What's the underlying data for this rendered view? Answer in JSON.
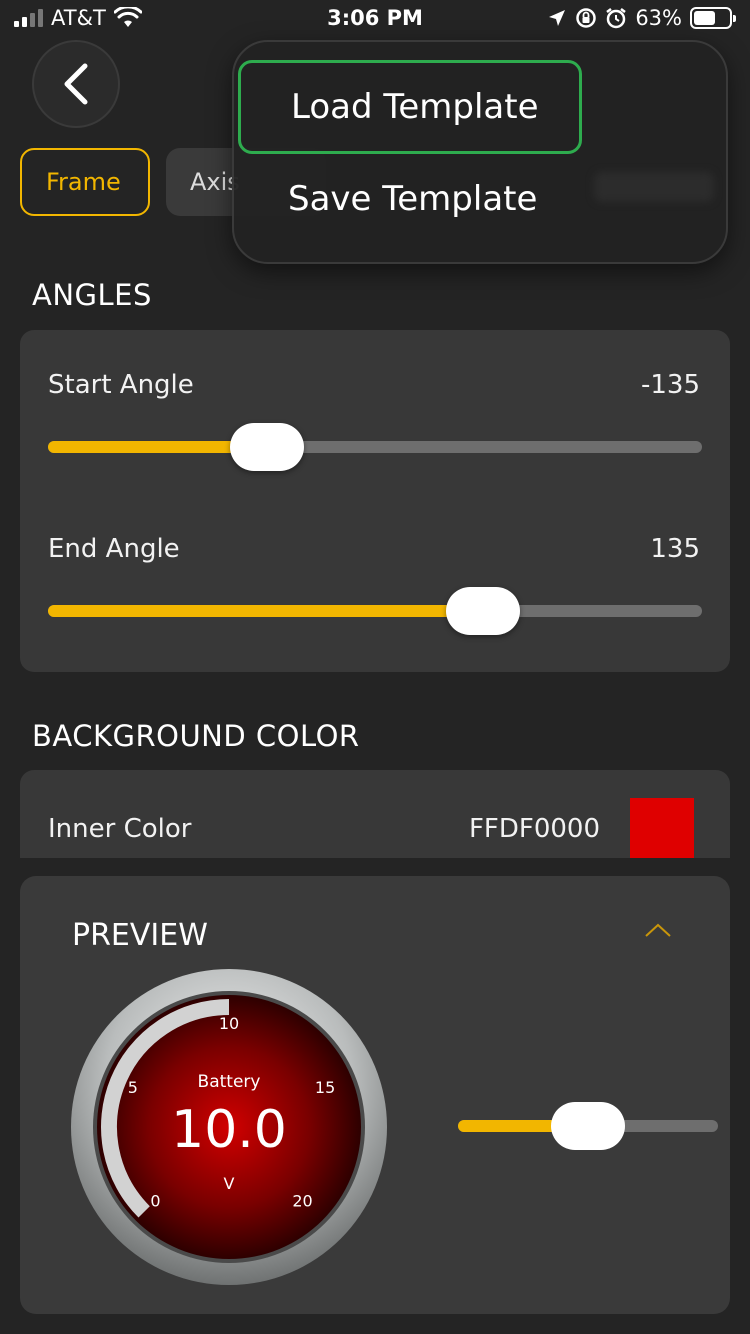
{
  "status": {
    "carrier": "AT&T",
    "time": "3:06 PM",
    "battery_percent": "63%",
    "battery_level": 0.63,
    "icons": [
      "signal-icon",
      "wifi-icon",
      "location-icon",
      "rotation-lock-icon",
      "alarm-icon",
      "battery-icon"
    ]
  },
  "nav": {
    "back_icon": "chevron-left-icon"
  },
  "tabs": [
    {
      "label": "Frame",
      "active": true
    },
    {
      "label": "Axis",
      "active": false
    }
  ],
  "menu": {
    "items": [
      {
        "label": "Load Template",
        "selected": true
      },
      {
        "label": "Save Template",
        "selected": false
      }
    ],
    "selected_border_color": "#2eac4e"
  },
  "angles": {
    "title": "ANGLES",
    "start": {
      "label": "Start Angle",
      "value": "-135",
      "fraction": 0.335
    },
    "end": {
      "label": "End Angle",
      "value": "135",
      "fraction": 0.665
    }
  },
  "background": {
    "title": "BACKGROUND COLOR",
    "inner": {
      "label": "Inner Color",
      "value": "FFDF0000",
      "swatch_color": "#df0000"
    }
  },
  "preview": {
    "title": "PREVIEW",
    "collapse_icon": "chevron-up-icon",
    "gauge": {
      "label": "Battery",
      "value": "10.0",
      "unit": "V",
      "ticks": [
        "0",
        "5",
        "10",
        "15",
        "20"
      ],
      "min": 0,
      "max": 20,
      "current": 10
    },
    "slider_fraction": 0.5
  },
  "colors": {
    "accent": "#f2b600",
    "background": "#242424",
    "card": "#383838"
  }
}
